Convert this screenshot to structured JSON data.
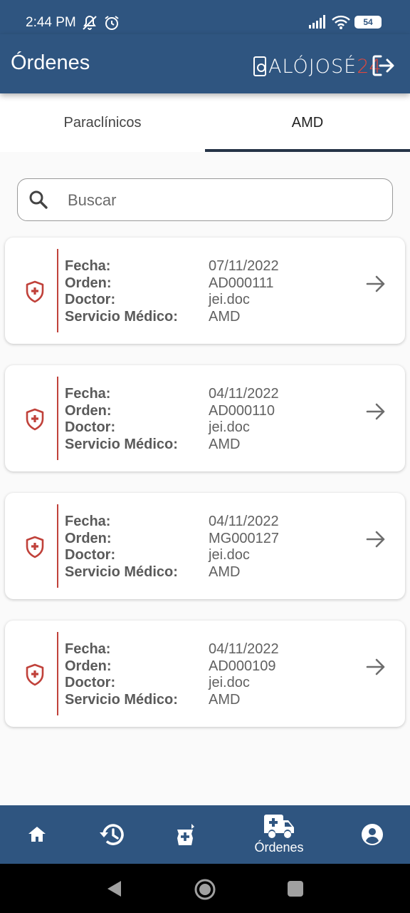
{
  "status_bar": {
    "time": "2:44 PM",
    "battery": "54",
    "icons": [
      "mute-icon",
      "alarm-icon",
      "signal-icon",
      "wifi-icon",
      "battery-icon"
    ]
  },
  "app_bar": {
    "title": "Órdenes",
    "logo_text": "ALÓJOSÉ",
    "logo_number": "24"
  },
  "tabs": [
    {
      "label": "Paraclínicos",
      "active": false
    },
    {
      "label": "AMD",
      "active": true
    }
  ],
  "search": {
    "placeholder": "Buscar",
    "value": ""
  },
  "field_labels": {
    "fecha": "Fecha:",
    "orden": "Orden:",
    "doctor": "Doctor:",
    "servicio": "Servicio Médico:"
  },
  "orders": [
    {
      "fecha": "07/11/2022",
      "orden": "AD000111",
      "doctor": "jei.doc",
      "servicio": "AMD"
    },
    {
      "fecha": "04/11/2022",
      "orden": "AD000110",
      "doctor": "jei.doc",
      "servicio": "AMD"
    },
    {
      "fecha": "04/11/2022",
      "orden": "MG000127",
      "doctor": "jei.doc",
      "servicio": "AMD"
    },
    {
      "fecha": "04/11/2022",
      "orden": "AD000109",
      "doctor": "jei.doc",
      "servicio": "AMD"
    }
  ],
  "bottom_nav": [
    {
      "icon": "home-icon",
      "label": ""
    },
    {
      "icon": "history-icon",
      "label": ""
    },
    {
      "icon": "pharmacy-icon",
      "label": ""
    },
    {
      "icon": "ambulance-icon",
      "label": "Órdenes",
      "active": true
    },
    {
      "icon": "account-icon",
      "label": ""
    }
  ],
  "colors": {
    "primary": "#2f5580",
    "accent": "#c0413a",
    "logo_accent": "#e0483d",
    "tab_indicator": "#263447",
    "background": "#fafafa"
  }
}
